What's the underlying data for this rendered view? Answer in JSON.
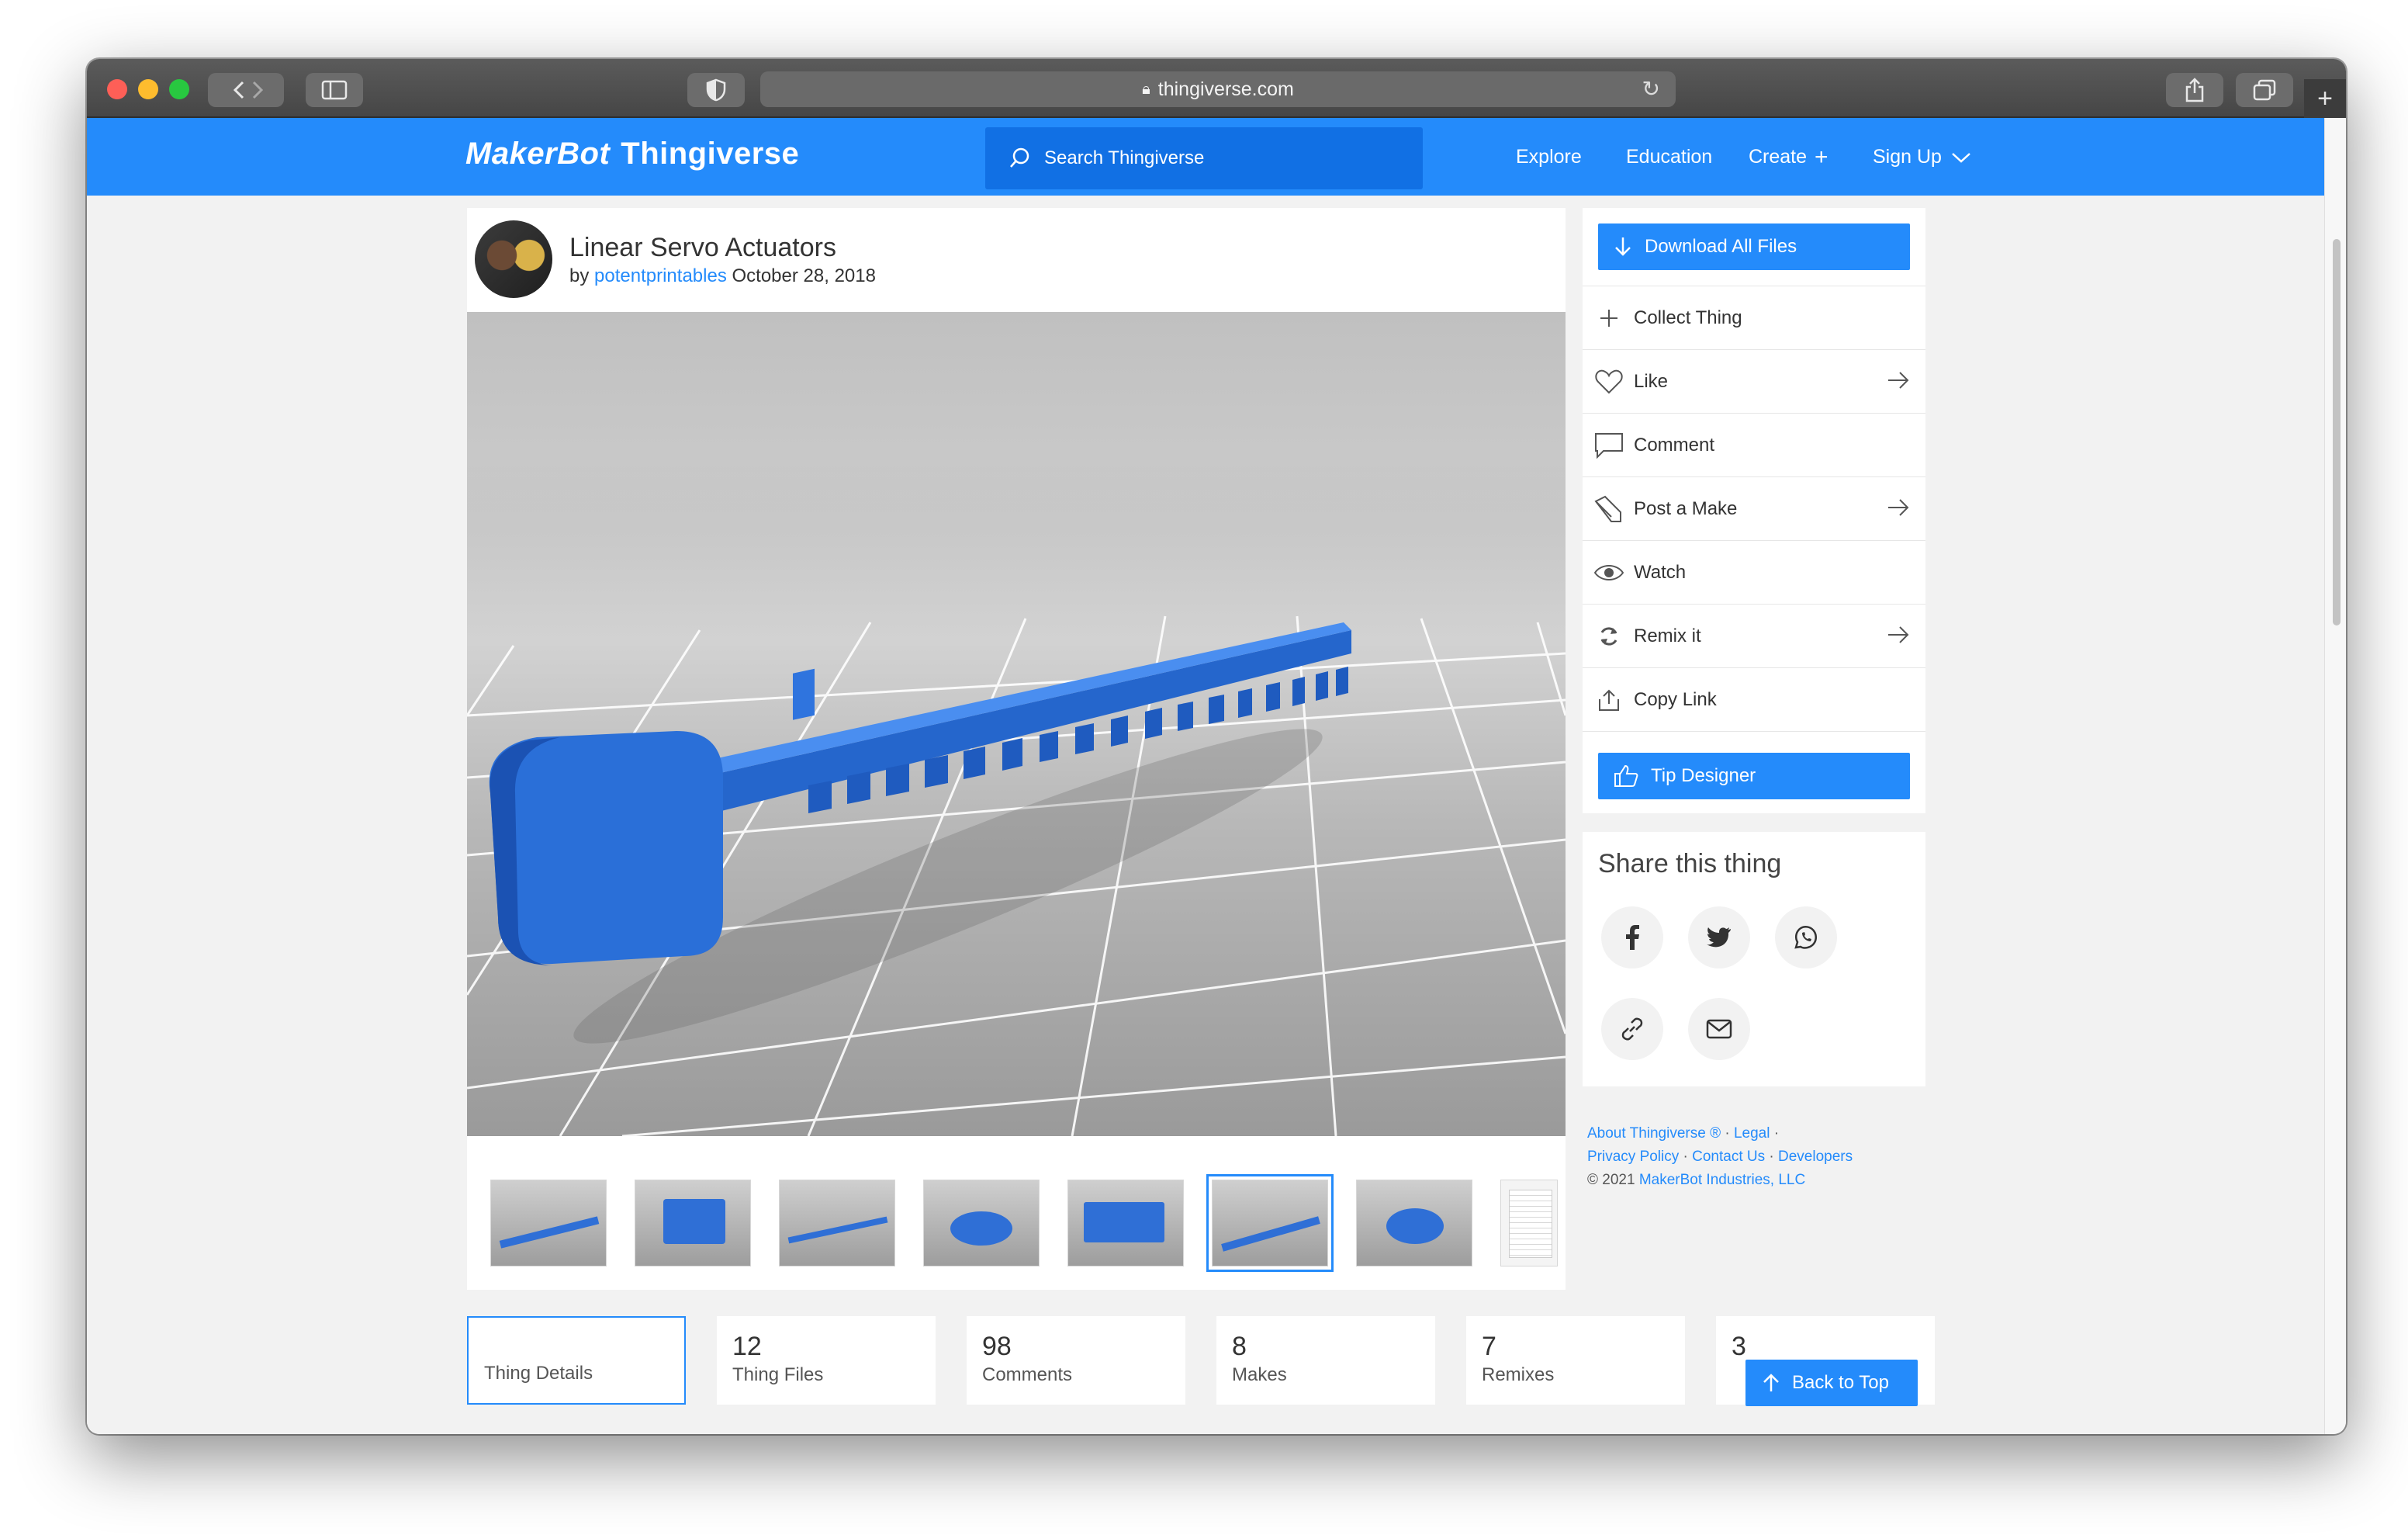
{
  "browser": {
    "url": "thingiverse.com"
  },
  "header": {
    "logo_maker": "MakerBot",
    "logo_thing": "Thingiverse",
    "search_placeholder": "Search Thingiverse",
    "nav": {
      "explore": "Explore",
      "education": "Education",
      "create": "Create",
      "signup": "Sign Up"
    },
    "colors": {
      "brand": "#248bfb",
      "search_bg": "#1170e4"
    }
  },
  "thing": {
    "title": "Linear Servo Actuators",
    "by": "by",
    "author": "potentprintables",
    "date": "October 28, 2018"
  },
  "thumbnails": [
    {
      "icon": "rack-thumb",
      "active": false
    },
    {
      "icon": "housing-thumb",
      "active": false
    },
    {
      "icon": "rack-thumb",
      "active": false
    },
    {
      "icon": "gear-thumb",
      "active": false
    },
    {
      "icon": "housing-thumb",
      "active": false
    },
    {
      "icon": "rack-thumb",
      "active": true
    },
    {
      "icon": "gear-thumb",
      "active": false
    },
    {
      "icon": "document-thumb",
      "active": false
    }
  ],
  "actions": {
    "download": "Download All Files",
    "collect": "Collect Thing",
    "like": "Like",
    "comment": "Comment",
    "post_make": "Post a Make",
    "watch": "Watch",
    "remix": "Remix it",
    "copy_link": "Copy Link",
    "tip": "Tip Designer"
  },
  "share": {
    "title": "Share this thing"
  },
  "footer": {
    "about": "About Thingiverse ®",
    "legal": "Legal",
    "privacy": "Privacy Policy",
    "contact": "Contact Us",
    "developers": "Developers",
    "copyright": "©  2021",
    "company": "MakerBot Industries, LLC"
  },
  "stats": [
    {
      "num": "",
      "label": "Thing Details",
      "active": true
    },
    {
      "num": "12",
      "label": "Thing Files",
      "active": false
    },
    {
      "num": "98",
      "label": "Comments",
      "active": false
    },
    {
      "num": "8",
      "label": "Makes",
      "active": false
    },
    {
      "num": "7",
      "label": "Remixes",
      "active": false
    },
    {
      "num": "3",
      "label": "",
      "active": false
    }
  ],
  "back_to_top": "Back to Top"
}
